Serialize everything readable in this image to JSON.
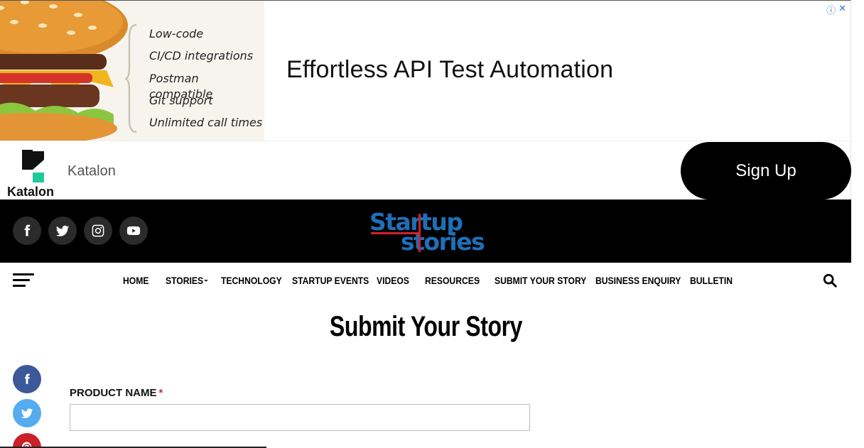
{
  "ad": {
    "features": [
      "Low-code",
      "CI/CD integrations",
      "Postman compatible",
      "Git support",
      "Unlimited call times"
    ],
    "headline": "Effortless API Test Automation",
    "advertiser": "Katalon",
    "logo_word": "Katalon",
    "cta_label": "Sign Up",
    "choices_icons": [
      "info-icon",
      "close-icon"
    ],
    "choices": {
      "info": "ⓘ",
      "close": "✕"
    }
  },
  "header": {
    "social": [
      "facebook-icon",
      "twitter-icon",
      "instagram-icon",
      "youtube-icon"
    ],
    "logo": {
      "line1": "Startup",
      "line2": "stories"
    }
  },
  "nav": {
    "items": [
      {
        "label": "HOME",
        "dropdown": false
      },
      {
        "label": "STORIES",
        "dropdown": true
      },
      {
        "label": "TECHNOLOGY",
        "dropdown": false
      },
      {
        "label": "STARTUP EVENTS",
        "dropdown": false
      },
      {
        "label": "VIDEOS",
        "dropdown": false
      },
      {
        "label": "RESOURCES",
        "dropdown": true
      },
      {
        "label": "SUBMIT YOUR STORY",
        "dropdown": false
      },
      {
        "label": "BUSINESS ENQUIRY",
        "dropdown": false
      },
      {
        "label": "BULLETIN",
        "dropdown": false
      }
    ]
  },
  "page": {
    "title": "Submit Your Story",
    "form": {
      "product_name_label": "PRODUCT NAME",
      "required_mark": "*",
      "product_name_value": ""
    }
  },
  "share": {
    "buttons": [
      {
        "icon": "facebook-icon",
        "color": "#3b5998"
      },
      {
        "icon": "twitter-icon",
        "color": "#55acee"
      },
      {
        "icon": "pinterest-icon",
        "color": "#cb2027"
      }
    ]
  },
  "colors": {
    "header_bg": "#000000",
    "logo_blue": "#1e6fb8",
    "logo_red": "#d4202a",
    "katalon_green": "#20c99a"
  }
}
